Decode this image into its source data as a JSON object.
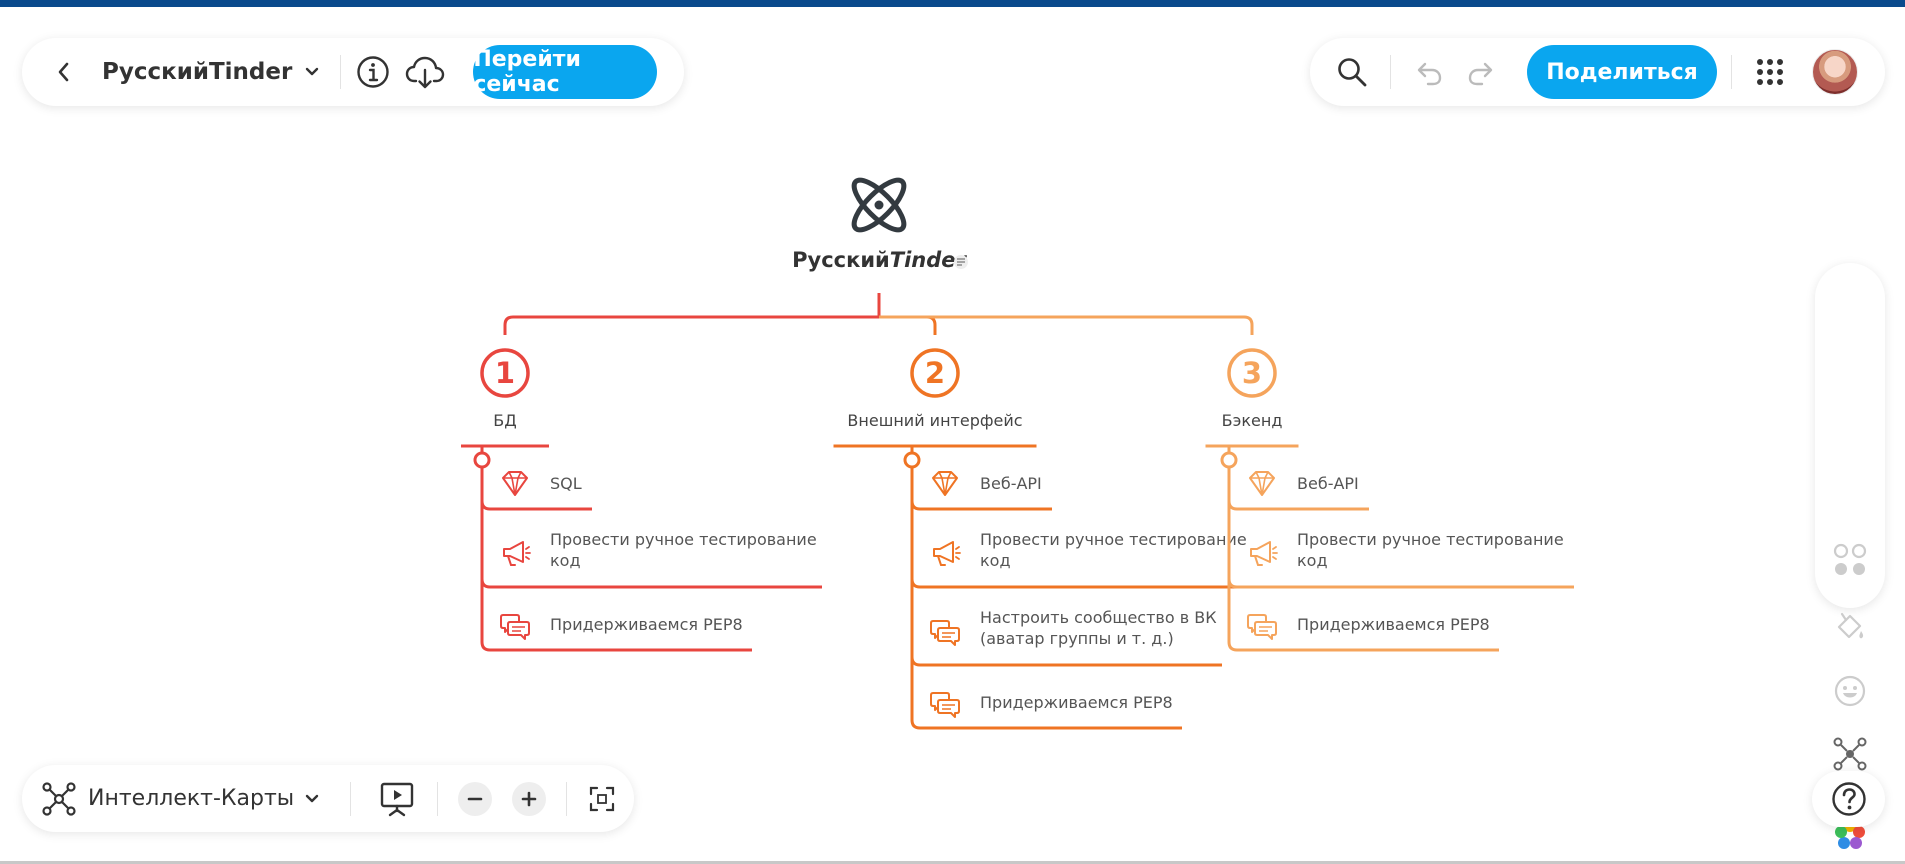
{
  "toolbar": {
    "doc_title": "РусскийTinder",
    "go_now_label": "Перейти сейчас",
    "share_label": "Поделиться"
  },
  "bottom_bar": {
    "view_mode_label": "Интеллект-Карты"
  },
  "map": {
    "root_title_part1": "Русский",
    "root_title_part2": "Tinder",
    "branches": [
      {
        "number": "1",
        "title": "БД",
        "color": "#e8463f",
        "items": [
          {
            "icon": "diamond-icon",
            "lines": [
              "SQL"
            ]
          },
          {
            "icon": "megaphone-icon",
            "lines": [
              "Провести ручное тестирование",
              "код"
            ]
          },
          {
            "icon": "chat-icon",
            "lines": [
              "Придерживаемся PEP8"
            ]
          }
        ]
      },
      {
        "number": "2",
        "title": "Внешний интерфейс",
        "color": "#ef7424",
        "items": [
          {
            "icon": "diamond-icon",
            "lines": [
              "Веб-API"
            ]
          },
          {
            "icon": "megaphone-icon",
            "lines": [
              "Провести ручное тестирование",
              "код"
            ]
          },
          {
            "icon": "chat-icon",
            "lines": [
              "Настроить сообщество в ВК",
              "(аватар группы и т. д.)"
            ]
          },
          {
            "icon": "chat-icon",
            "lines": [
              "Придерживаемся PEP8"
            ]
          }
        ]
      },
      {
        "number": "3",
        "title": "Бэкенд",
        "color": "#f5a45c",
        "items": [
          {
            "icon": "diamond-icon",
            "lines": [
              "Веб-API"
            ]
          },
          {
            "icon": "megaphone-icon",
            "lines": [
              "Провести ручное тестирование",
              "код"
            ]
          },
          {
            "icon": "chat-icon",
            "lines": [
              "Придерживаемся PEP8"
            ]
          }
        ]
      }
    ]
  },
  "colors": {
    "accent": "#0aa6ef",
    "top_stripe": "#0a4a8c",
    "root_icon": "#333a40"
  }
}
